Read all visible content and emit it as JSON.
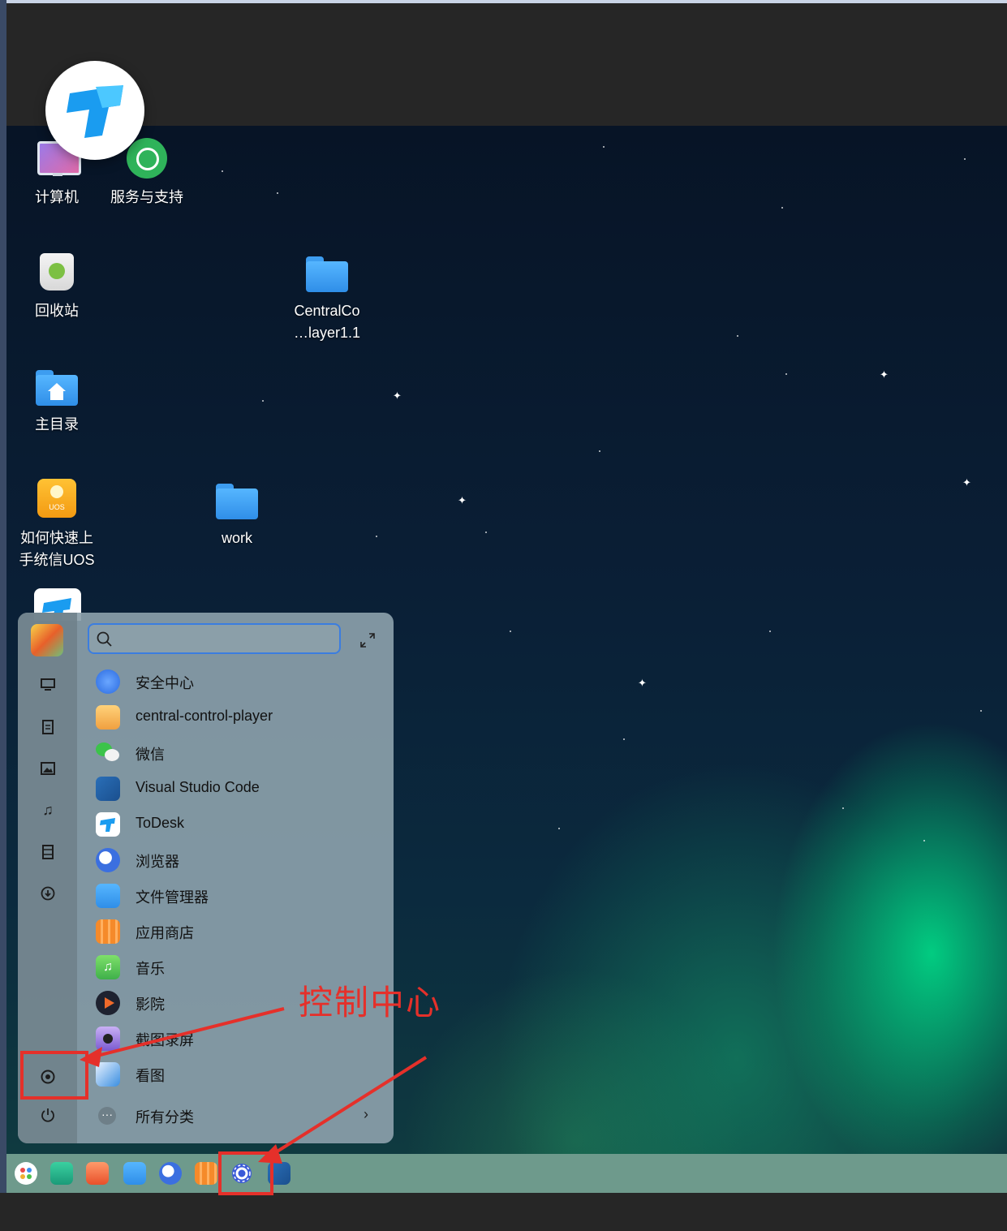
{
  "desktop": {
    "icons": [
      {
        "label": "计算机",
        "icon": "computer-icon"
      },
      {
        "label": "服务与支持",
        "icon": "support-headset-icon"
      },
      {
        "label": "回收站",
        "icon": "trash-icon"
      },
      {
        "label": "CentralCo\n…layer1.1",
        "line1": "CentralCo",
        "line2": "…layer1.1",
        "icon": "folder-icon"
      },
      {
        "label": "主目录",
        "icon": "home-folder-icon"
      },
      {
        "label": "如何快速上手统信UOS",
        "line1": "如何快速上",
        "line2": "手统信UOS",
        "icon": "uos-guide-icon"
      },
      {
        "label": "work",
        "icon": "folder-icon"
      }
    ]
  },
  "launcher": {
    "search_placeholder": "",
    "apps": [
      {
        "name": "安全中心",
        "icon": "security-center-icon",
        "color": "#3a7de8"
      },
      {
        "name": "central-control-player",
        "icon": "central-control-player-icon",
        "color": "#f0a040"
      },
      {
        "name": "微信",
        "icon": "wechat-icon",
        "color": "#3cc34a"
      },
      {
        "name": "Visual Studio Code",
        "icon": "vscode-icon",
        "color": "#2a6fb8"
      },
      {
        "name": "ToDesk",
        "icon": "todesk-icon",
        "color": "#1a8ef0"
      },
      {
        "name": "浏览器",
        "icon": "browser-icon",
        "color": "#3b6fe0"
      },
      {
        "name": "文件管理器",
        "icon": "file-manager-icon",
        "color": "#2f8ee8"
      },
      {
        "name": "应用商店",
        "icon": "app-store-icon",
        "color": "#f07a2a"
      },
      {
        "name": "音乐",
        "icon": "music-icon",
        "color": "#4cc04c"
      },
      {
        "name": "影院",
        "icon": "movie-icon",
        "color": "#222222"
      },
      {
        "name": "截图录屏",
        "icon": "screenshot-icon",
        "color": "#7a5ad0"
      },
      {
        "name": "看图",
        "icon": "image-viewer-icon",
        "color": "#3a8ee0"
      }
    ],
    "all_categories": "所有分类"
  },
  "annotation": {
    "label": "控制中心",
    "color": "#e5302a"
  },
  "taskbar": {
    "icons": [
      "launcher-icon",
      "terminal-icon",
      "multitask-view-icon",
      "file-manager-icon",
      "browser-icon",
      "app-store-icon",
      "control-center-icon",
      "vscode-icon"
    ]
  }
}
